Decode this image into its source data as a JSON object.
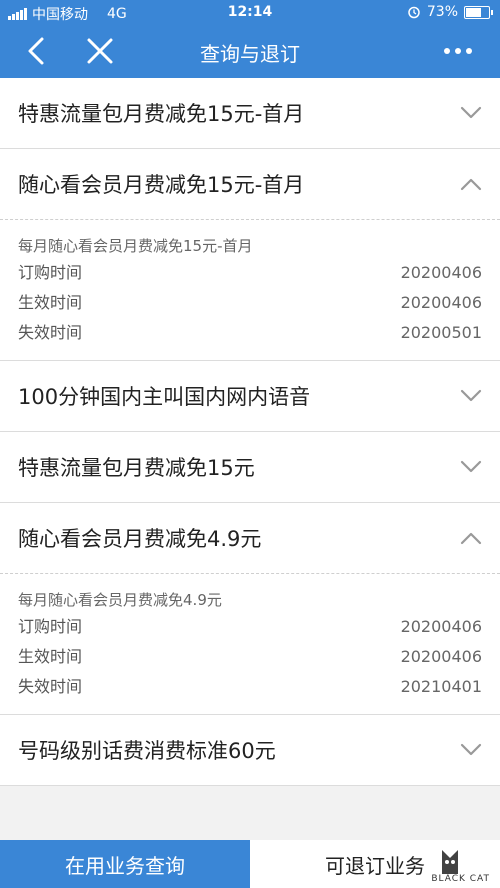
{
  "status": {
    "carrier": "中国移动",
    "network": "4G",
    "time": "12:14",
    "battery": "73%",
    "battery_level": 0.73
  },
  "nav": {
    "title": "查询与退订",
    "back_icon": "chevron-left-icon",
    "close_icon": "close-icon",
    "more_icon": "more-dots-icon"
  },
  "items": [
    {
      "title": "特惠流量包月费减免15元-首月",
      "expanded": false
    },
    {
      "title": "随心看会员月费减免15元-首月",
      "expanded": true,
      "subtitle": "每月随心看会员月费减免15元-首月",
      "fields": [
        {
          "label": "订购时间",
          "value": "20200406"
        },
        {
          "label": "生效时间",
          "value": "20200406"
        },
        {
          "label": "失效时间",
          "value": "20200501"
        }
      ]
    },
    {
      "title": "100分钟国内主叫国内网内语音",
      "expanded": false
    },
    {
      "title": "特惠流量包月费减免15元",
      "expanded": false
    },
    {
      "title": "随心看会员月费减免4.9元",
      "expanded": true,
      "subtitle": "每月随心看会员月费减免4.9元",
      "fields": [
        {
          "label": "订购时间",
          "value": "20200406"
        },
        {
          "label": "生效时间",
          "value": "20200406"
        },
        {
          "label": "失效时间",
          "value": "20210401"
        }
      ]
    },
    {
      "title": "号码级别话费消费标准60元",
      "expanded": false
    }
  ],
  "tabs": {
    "active": "在用业务查询",
    "other": "可退订业务"
  },
  "watermark": {
    "label": "BLACK CAT",
    "icon": "black-cat-logo"
  },
  "colors": {
    "primary": "#3a86d6"
  }
}
